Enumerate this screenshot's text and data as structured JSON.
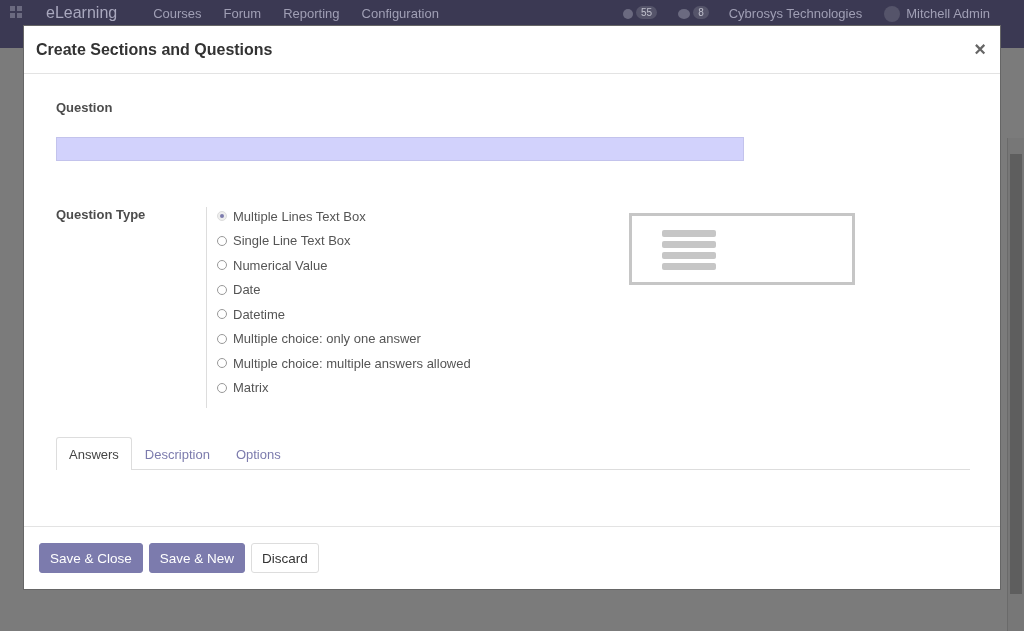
{
  "navbar": {
    "app_name": "eLearning",
    "menu": [
      "Courses",
      "Forum",
      "Reporting",
      "Configuration"
    ],
    "activity_count": "55",
    "message_count": "8",
    "company": "Cybrosys Technologies",
    "user": "Mitchell Admin"
  },
  "dialog": {
    "title": "Create Sections and Questions",
    "close": "×",
    "question": {
      "label": "Question"
    },
    "question_type": {
      "label": "Question Type",
      "options": [
        {
          "label": "Multiple Lines Text Box",
          "selected": true
        },
        {
          "label": "Single Line Text Box",
          "selected": false
        },
        {
          "label": "Numerical Value",
          "selected": false
        },
        {
          "label": "Date",
          "selected": false
        },
        {
          "label": "Datetime",
          "selected": false
        },
        {
          "label": "Multiple choice: only one answer",
          "selected": false
        },
        {
          "label": "Multiple choice: multiple answers allowed",
          "selected": false
        },
        {
          "label": "Matrix",
          "selected": false
        }
      ]
    },
    "tabs": [
      {
        "label": "Answers",
        "selected": true
      },
      {
        "label": "Description",
        "selected": false
      },
      {
        "label": "Options",
        "selected": false
      }
    ],
    "buttons": [
      {
        "label": "Save & Close",
        "kind": "primary"
      },
      {
        "label": "Save & New",
        "kind": "primary"
      },
      {
        "label": "Discard",
        "kind": "secondary"
      }
    ]
  }
}
